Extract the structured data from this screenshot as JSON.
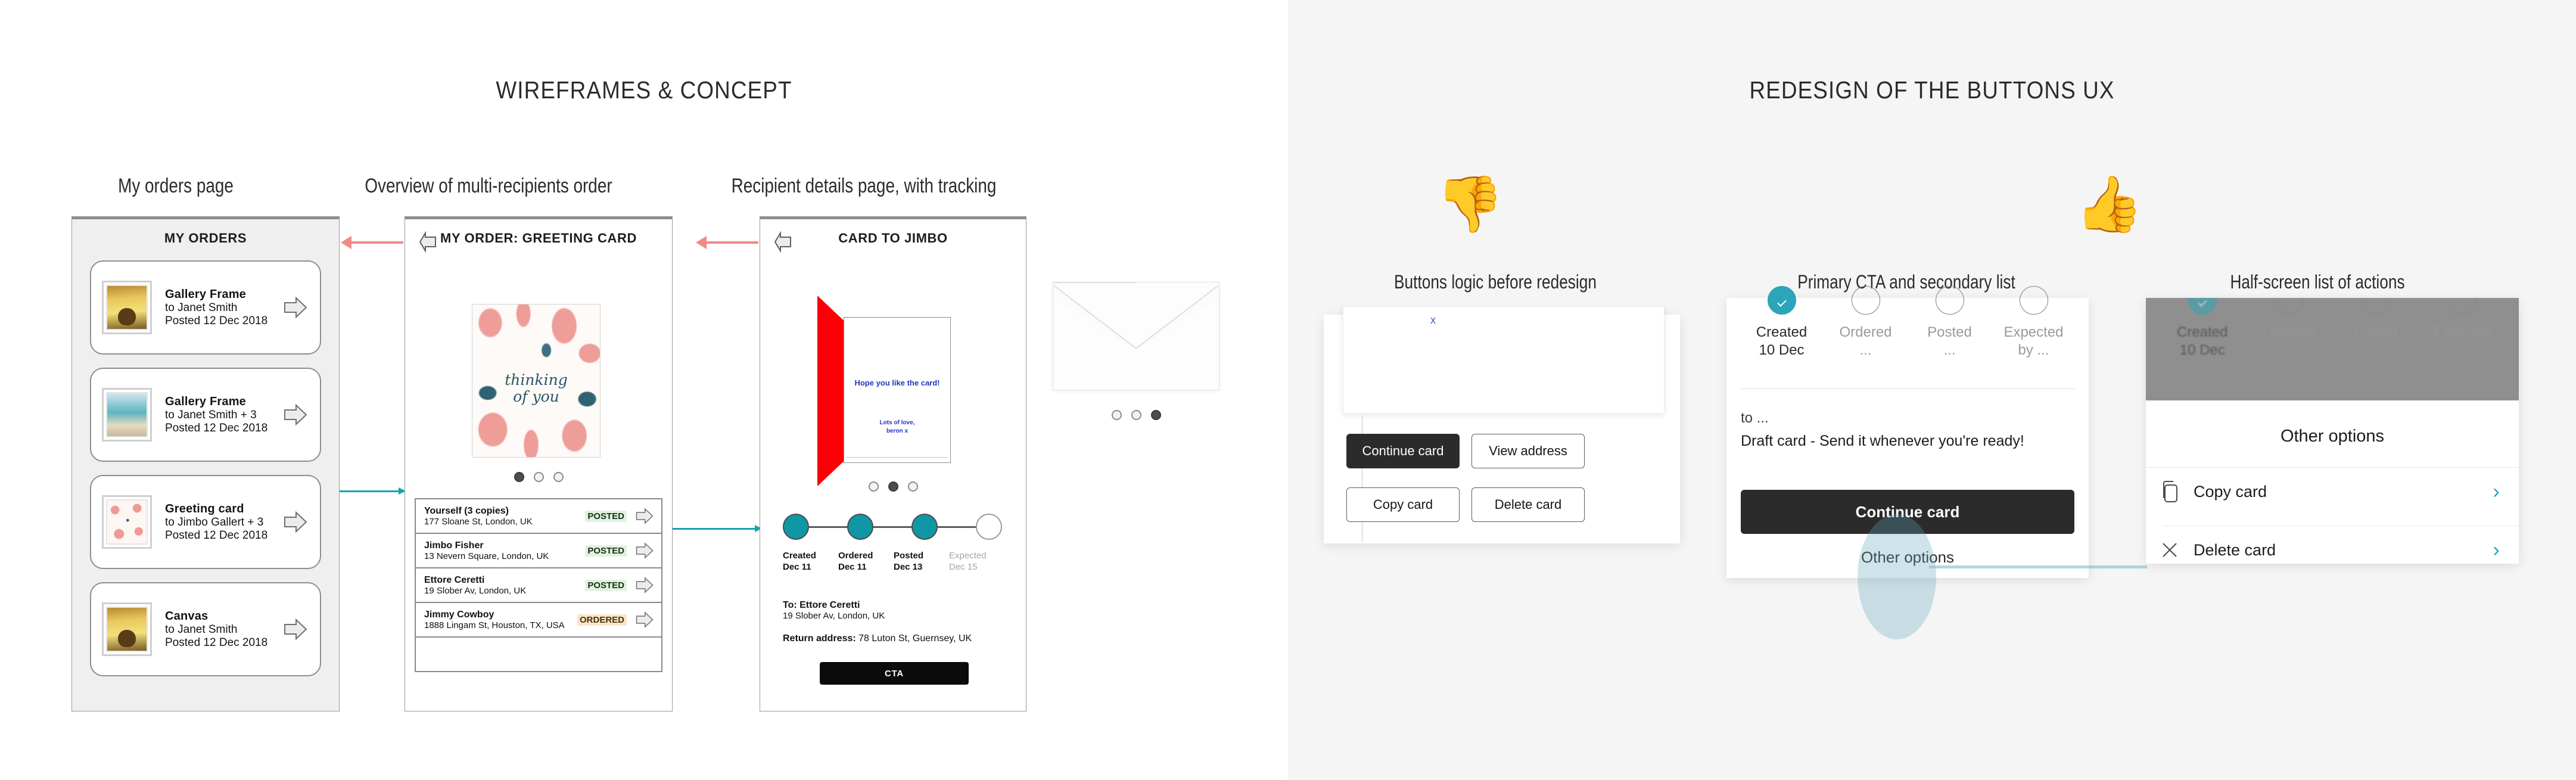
{
  "left": {
    "section_title": "WIREFRAMES & CONCEPT",
    "captions": [
      "My orders page",
      "Overview of multi-recipients order",
      "Recipient details page, with tracking"
    ],
    "frame1": {
      "title": "MY ORDERS",
      "orders": [
        {
          "name": "Gallery Frame",
          "to": "to Janet Smith",
          "date": "Posted 12 Dec 2018",
          "thumb": "dog-photo-thumb"
        },
        {
          "name": "Gallery Frame",
          "to": "to Janet Smith + 3",
          "date": "Posted 12 Dec 2018",
          "thumb": "beach-photo-thumb"
        },
        {
          "name": "Greeting card",
          "to": "to Jimbo Gallert  + 3",
          "date": "Posted 12 Dec 2018",
          "thumb": "floral-card-thumb"
        },
        {
          "name": "Canvas",
          "to": "to Janet Smith",
          "date": "Posted 12 Dec 2018",
          "thumb": "dog-photo-thumb"
        }
      ]
    },
    "frame2": {
      "title": "MY ORDER: GREETING CARD",
      "card_script_line1": "thinking",
      "card_script_line2": "of you",
      "recipients": [
        {
          "name": "Yourself (3 copies)",
          "address": "177 Sloane St, London, UK",
          "status": "POSTED"
        },
        {
          "name": "Jimbo Fisher",
          "address": "13 Nevern Square, London, UK",
          "status": "POSTED"
        },
        {
          "name": "Ettore Ceretti",
          "address": "19 Slober Av, London, UK",
          "status": "POSTED"
        },
        {
          "name": "Jimmy Cowboy",
          "address": "1888 Lingam St, Houston, TX, USA",
          "status": "ORDERED"
        }
      ]
    },
    "frame3": {
      "title": "CARD TO JIMBO",
      "card_message": "Hope you like the card!",
      "card_sign_line1": "Lots of love,",
      "card_sign_line2": "beron x",
      "tracking": [
        {
          "label": "Created",
          "date": "Dec 11",
          "done": true
        },
        {
          "label": "Ordered",
          "date": "Dec 11",
          "done": true
        },
        {
          "label": "Posted",
          "date": "Dec 13",
          "done": true
        },
        {
          "label": "Expected",
          "date": "Dec 15",
          "done": false
        }
      ],
      "to_label": "To: Ettore Ceretti",
      "to_address": "19 Slober Av, London, UK",
      "return_label": "Return address:",
      "return_address": " 78 Luton St, Guernsey, UK",
      "cta_label": "CTA"
    }
  },
  "right": {
    "section_title": "REDESIGN OF THE BUTTONS UX",
    "thumb_down_icon": "👎",
    "thumb_up_icon": "👍",
    "captions": [
      "Buttons logic before redesign",
      "Primary CTA and secondary list",
      "Half-screen list of actions"
    ],
    "mock_a": {
      "close_label": "x",
      "buttons": [
        {
          "label": "Continue card",
          "style": "primary"
        },
        {
          "label": "View address",
          "style": "secondary"
        },
        {
          "label": "Copy card",
          "style": "secondary"
        },
        {
          "label": "Delete card",
          "style": "secondary"
        }
      ]
    },
    "mock_b": {
      "steps": [
        {
          "label": "Created",
          "sub": "10 Dec",
          "done": true
        },
        {
          "label": "Ordered",
          "sub": "...",
          "done": false
        },
        {
          "label": "Posted",
          "sub": "...",
          "done": false
        },
        {
          "label": "Expected",
          "sub": "by ...",
          "done": false
        }
      ],
      "to_line": "to ...",
      "draft_line": "Draft card - Send it whenever you're ready!",
      "primary_cta": "Continue card",
      "secondary_link": "Other options"
    },
    "mock_c": {
      "steps": [
        {
          "label": "Created",
          "sub": "10 Dec",
          "done": true
        },
        {
          "label": "Ordered",
          "sub": "...",
          "done": false
        },
        {
          "label": "Posted",
          "sub": "...",
          "done": false
        },
        {
          "label": "Expected",
          "sub": "...",
          "done": false
        }
      ],
      "sheet_title": "Other options",
      "actions": [
        {
          "label": "Copy card",
          "icon": "copy-icon",
          "chevron": "›"
        },
        {
          "label": "Delete card",
          "icon": "cross-icon",
          "chevron": "›"
        }
      ]
    },
    "accent_teal": "#1aa7bb",
    "highlight_fill": "rgba(97,166,185,0.30)"
  }
}
